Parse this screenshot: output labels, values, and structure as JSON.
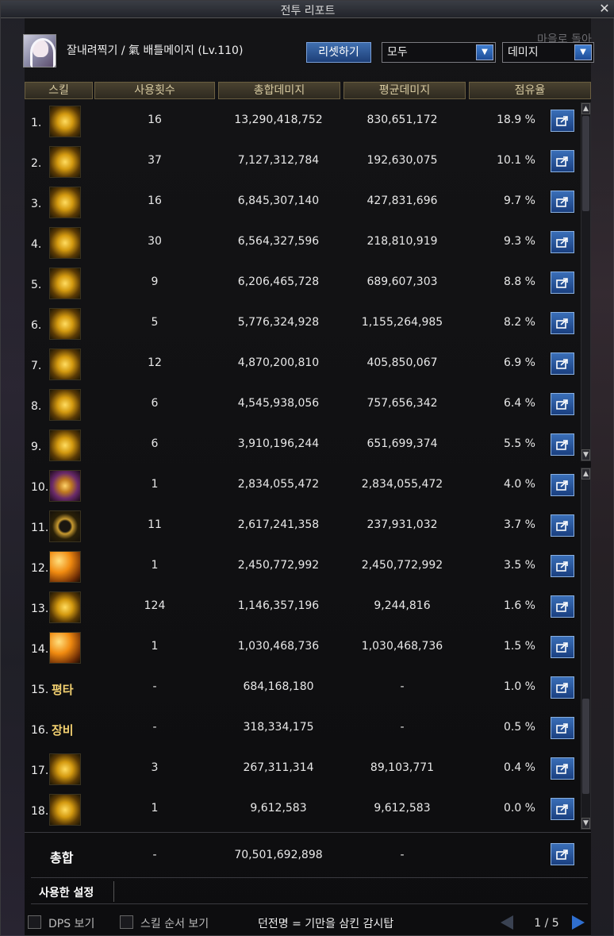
{
  "window": {
    "title": "전투 리포트",
    "close_label": "✕"
  },
  "header": {
    "character": "잘내려찍기 / 氣 배틀메이지 (Lv.110)",
    "reset_label": "리셋하기",
    "filter_value": "모두",
    "type_value": "데미지",
    "overlay_text": "마을로 돌아"
  },
  "columns": [
    "스킬",
    "사용횟수",
    "총합데미지",
    "평균데미지",
    "점유율"
  ],
  "rows": [
    {
      "rank": "1.",
      "skill_text": "",
      "count": "16",
      "total": "13,290,418,752",
      "avg": "830,651,172",
      "share": "18.9 %"
    },
    {
      "rank": "2.",
      "skill_text": "",
      "count": "37",
      "total": "7,127,312,784",
      "avg": "192,630,075",
      "share": "10.1 %"
    },
    {
      "rank": "3.",
      "skill_text": "",
      "count": "16",
      "total": "6,845,307,140",
      "avg": "427,831,696",
      "share": "9.7 %"
    },
    {
      "rank": "4.",
      "skill_text": "",
      "count": "30",
      "total": "6,564,327,596",
      "avg": "218,810,919",
      "share": "9.3 %"
    },
    {
      "rank": "5.",
      "skill_text": "",
      "count": "9",
      "total": "6,206,465,728",
      "avg": "689,607,303",
      "share": "8.8 %"
    },
    {
      "rank": "6.",
      "skill_text": "",
      "count": "5",
      "total": "5,776,324,928",
      "avg": "1,155,264,985",
      "share": "8.2 %"
    },
    {
      "rank": "7.",
      "skill_text": "",
      "count": "12",
      "total": "4,870,200,810",
      "avg": "405,850,067",
      "share": "6.9 %"
    },
    {
      "rank": "8.",
      "skill_text": "",
      "count": "6",
      "total": "4,545,938,056",
      "avg": "757,656,342",
      "share": "6.4 %"
    },
    {
      "rank": "9.",
      "skill_text": "",
      "count": "6",
      "total": "3,910,196,244",
      "avg": "651,699,374",
      "share": "5.5 %"
    },
    {
      "rank": "10.",
      "skill_text": "",
      "count": "1",
      "total": "2,834,055,472",
      "avg": "2,834,055,472",
      "share": "4.0 %"
    },
    {
      "rank": "11.",
      "skill_text": "",
      "count": "11",
      "total": "2,617,241,358",
      "avg": "237,931,032",
      "share": "3.7 %"
    },
    {
      "rank": "12.",
      "skill_text": "",
      "count": "1",
      "total": "2,450,772,992",
      "avg": "2,450,772,992",
      "share": "3.5 %"
    },
    {
      "rank": "13.",
      "skill_text": "",
      "count": "124",
      "total": "1,146,357,196",
      "avg": "9,244,816",
      "share": "1.6 %"
    },
    {
      "rank": "14.",
      "skill_text": "",
      "count": "1",
      "total": "1,030,468,736",
      "avg": "1,030,468,736",
      "share": "1.5 %"
    },
    {
      "rank": "15.",
      "skill_text": "평타",
      "count": "-",
      "total": "684,168,180",
      "avg": "-",
      "share": "1.0 %"
    },
    {
      "rank": "16.",
      "skill_text": "장비",
      "count": "-",
      "total": "318,334,175",
      "avg": "-",
      "share": "0.5 %"
    },
    {
      "rank": "17.",
      "skill_text": "",
      "count": "3",
      "total": "267,311,314",
      "avg": "89,103,771",
      "share": "0.4 %"
    },
    {
      "rank": "18.",
      "skill_text": "",
      "count": "1",
      "total": "9,612,583",
      "avg": "9,612,583",
      "share": "0.0 %"
    }
  ],
  "total": {
    "label": "총합",
    "count": "-",
    "total": "70,501,692,898",
    "avg": "-"
  },
  "used_settings": {
    "label": "사용한 설정"
  },
  "footer": {
    "dps_label": "DPS 보기",
    "skill_order_label": "스킬 순서 보기",
    "dungeon": "던전명 = 기만을 삼킨 감시탑",
    "page": "1 / 5"
  }
}
